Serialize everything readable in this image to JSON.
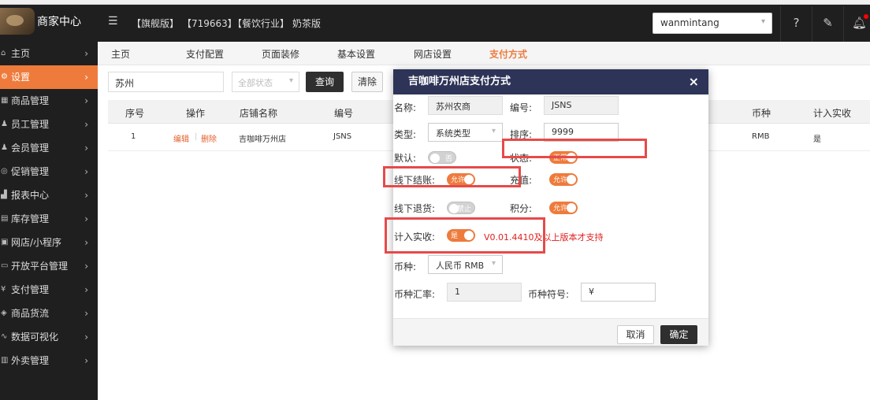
{
  "header": {
    "brand": "商家中心",
    "menu_icon": "menu-fold-icon",
    "tags": [
      "【旗舰版】",
      "【719663】",
      "【餐饮行业】",
      "奶茶版"
    ],
    "username": "wanmintang",
    "icons": [
      "help-icon",
      "edit-icon",
      "bell-icon"
    ]
  },
  "sidebar": {
    "items": [
      {
        "label": "主页",
        "icon": "home-icon"
      },
      {
        "label": "设置",
        "icon": "gear-icon"
      },
      {
        "label": "商品管理",
        "icon": "goods-icon"
      },
      {
        "label": "员工管理",
        "icon": "user-icon"
      },
      {
        "label": "会员管理",
        "icon": "member-icon"
      },
      {
        "label": "促销管理",
        "icon": "promo-icon"
      },
      {
        "label": "报表中心",
        "icon": "chart-icon"
      },
      {
        "label": "库存管理",
        "icon": "stock-icon"
      },
      {
        "label": "网店/小程序",
        "icon": "shop-icon"
      },
      {
        "label": "开放平台管理",
        "icon": "platform-icon"
      },
      {
        "label": "支付管理",
        "icon": "pay-icon"
      },
      {
        "label": "商品货流",
        "icon": "logistics-icon"
      },
      {
        "label": "数据可视化",
        "icon": "visual-icon"
      },
      {
        "label": "外卖管理",
        "icon": "takeout-icon"
      }
    ],
    "active_index": 1
  },
  "tabs": [
    "主页",
    "支付配置",
    "页面装修",
    "基本设置",
    "网店设置",
    "支付方式"
  ],
  "filter": {
    "keyword": "苏州",
    "status_placeholder": "全部状态",
    "query_label": "查询",
    "clear_label": "清除"
  },
  "table": {
    "headers": [
      "序号",
      "操作",
      "店铺名称",
      "编号",
      "币种",
      "计入实收"
    ],
    "row": {
      "index": "1",
      "edit": "编辑",
      "delete": "删除",
      "store": "吉咖啡万州店",
      "code": "JSNS",
      "currency": "RMB",
      "counted": "是"
    }
  },
  "modal": {
    "title": "吉咖啡万州店支付方式",
    "close": "×",
    "name_label": "名称:",
    "name_value": "苏州农商",
    "code_label": "编号:",
    "code_value": "JSNS",
    "type_label": "类型:",
    "type_value": "系统类型",
    "sort_label": "排序:",
    "sort_value": "9999",
    "default_label": "默认:",
    "default_toggle": "否",
    "status_label": "状态:",
    "status_toggle": "正常",
    "offline_checkout_label": "线下结账:",
    "offline_checkout_toggle": "允许",
    "recharge_label": "充值:",
    "recharge_toggle": "允许",
    "offline_return_label": "线下退货:",
    "offline_return_toggle": "禁止",
    "points_label": "积分:",
    "points_toggle": "允许",
    "counted_label": "计入实收:",
    "counted_toggle": "是",
    "version_note": "V0.01.4410及以上版本才支持",
    "currency_label": "币种:",
    "currency_value": "人民币 RMB",
    "rate_label": "币种汇率:",
    "rate_value": "1",
    "symbol_label": "币种符号:",
    "symbol_value": "¥",
    "cancel_label": "取消",
    "ok_label": "确定"
  },
  "colors": {
    "accent": "#ee7b3c",
    "modal_header": "#2d3457",
    "highlight": "#e64a4a",
    "dark": "#1f1f1f"
  }
}
